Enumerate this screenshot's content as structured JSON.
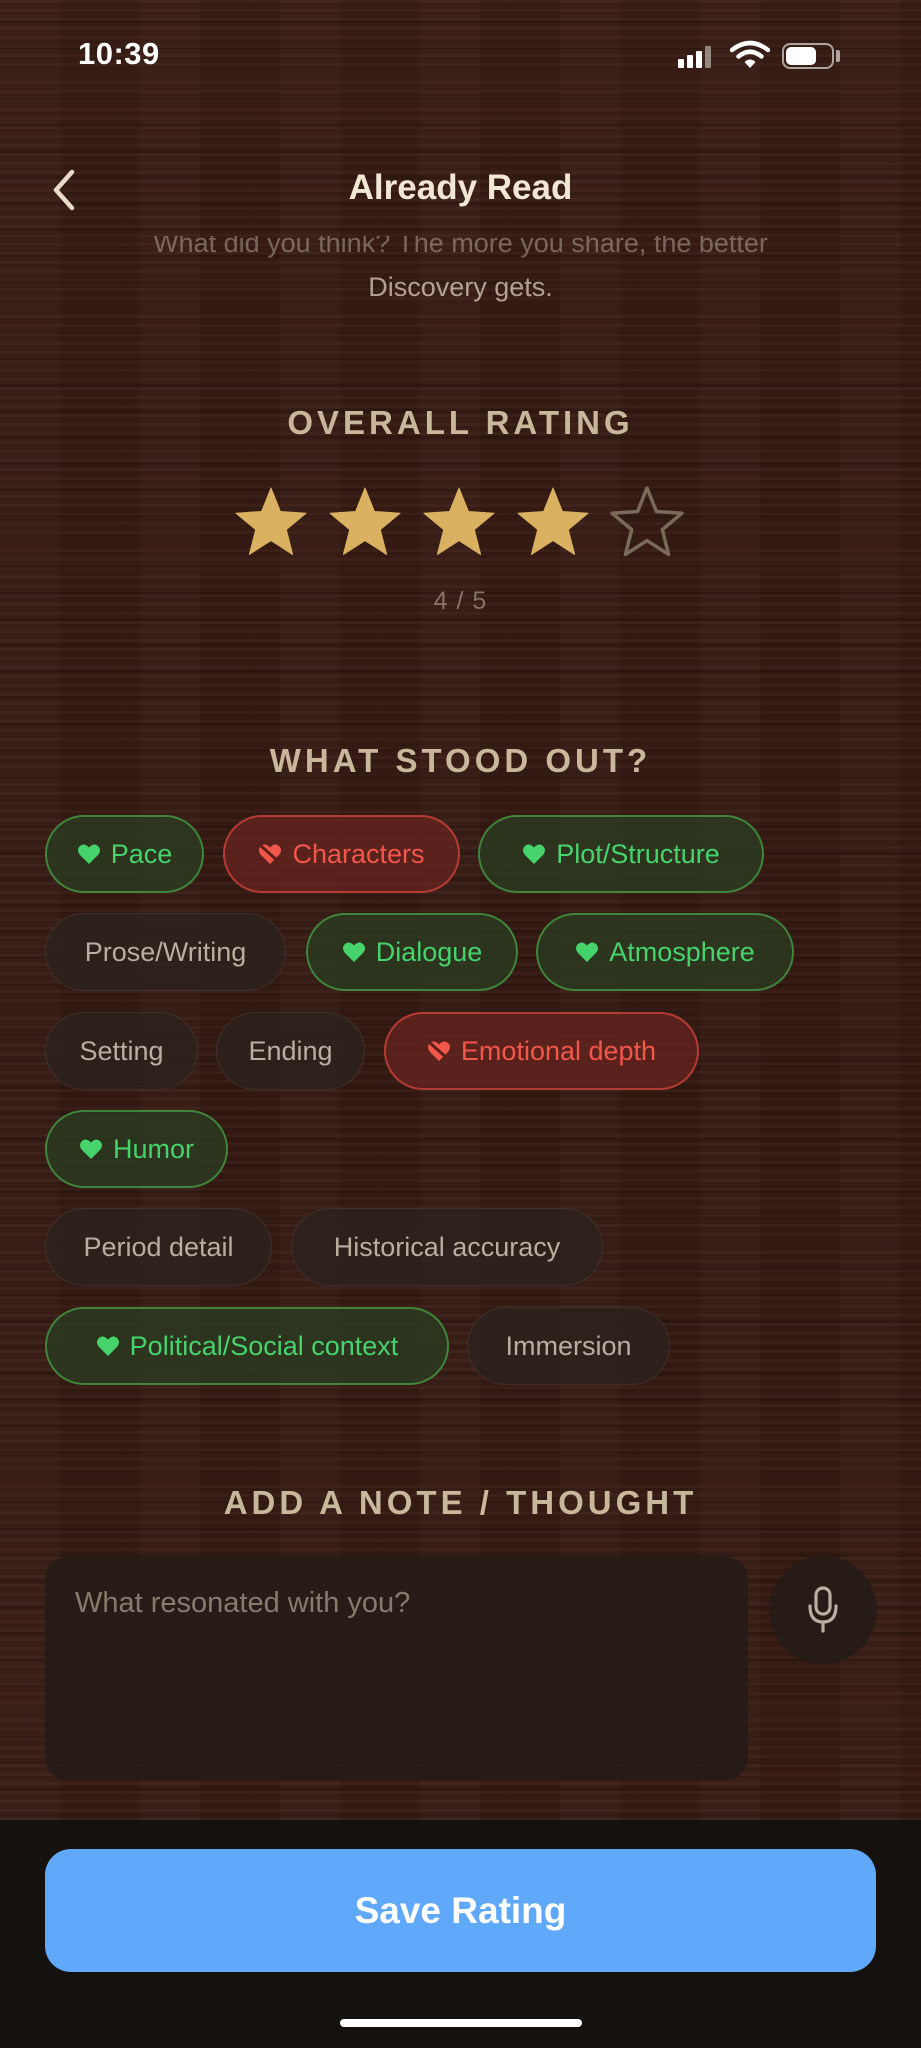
{
  "status_bar": {
    "time": "10:39"
  },
  "header": {
    "title": "Already Read",
    "back_icon": "chevron-left-icon"
  },
  "intro": {
    "line_partial": "What did you think? The more you share, the better",
    "line_2": "Discovery gets."
  },
  "rating": {
    "heading": "OVERALL RATING",
    "value": 4,
    "max": 5,
    "caption": "4 / 5",
    "filled_color": "#d9b160",
    "empty_color": "#7a6a5a"
  },
  "stood_out": {
    "heading": "WHAT STOOD OUT?",
    "chips": [
      {
        "label": "Pace",
        "state": "liked"
      },
      {
        "label": "Characters",
        "state": "disliked"
      },
      {
        "label": "Plot/Structure",
        "state": "liked"
      },
      {
        "label": "Prose/Writing",
        "state": "neutral"
      },
      {
        "label": "Dialogue",
        "state": "liked"
      },
      {
        "label": "Atmosphere",
        "state": "liked"
      },
      {
        "label": "Setting",
        "state": "neutral"
      },
      {
        "label": "Ending",
        "state": "neutral"
      },
      {
        "label": "Emotional depth",
        "state": "disliked"
      },
      {
        "label": "Humor",
        "state": "liked"
      },
      {
        "label": "Period detail",
        "state": "neutral"
      },
      {
        "label": "Historical accuracy",
        "state": "neutral"
      },
      {
        "label": "Political/Social context",
        "state": "liked"
      },
      {
        "label": "Immersion",
        "state": "neutral"
      }
    ],
    "colors": {
      "liked": "#46d36c",
      "disliked": "#f2574c",
      "neutral": "#b9aea1"
    }
  },
  "note": {
    "heading": "ADD A NOTE / THOUGHT",
    "placeholder": "What resonated with you?",
    "value": "",
    "mic_icon": "microphone-icon"
  },
  "footer": {
    "save_label": "Save Rating",
    "accent": "#5fa8fa"
  }
}
